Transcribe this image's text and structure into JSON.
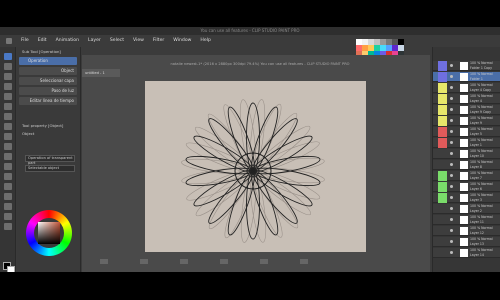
{
  "window": {
    "title": "You can use all features - CLIP STUDIO PAINT PRO",
    "menu": [
      "File",
      "Edit",
      "Animation",
      "Layer",
      "Select",
      "View",
      "Filter",
      "Window",
      "Help"
    ]
  },
  "document": {
    "tab": "untitled - 1",
    "path": "natalie newest-1* (2016 x 2880px 300dpi 79.4%) You can use all features - CLIP STUDIO PAINT PRO"
  },
  "sub_tool": {
    "header": "Sub Tool [Operation]",
    "items": [
      {
        "label": "Operation",
        "selected": true
      },
      {
        "label": "Object",
        "selected": false
      },
      {
        "label": "Seleccionar capa",
        "selected": false
      },
      {
        "label": "Paso de luz",
        "selected": false
      },
      {
        "label": "Editar línea de tiempo",
        "selected": false
      }
    ],
    "property_header": "Tool property [Object]",
    "property_label": "Object",
    "fields": [
      "Operation of transparent part",
      "Selectable object"
    ]
  },
  "layers": [
    {
      "name": "100 % Normal Folder 1 Copy",
      "tag": "#6f6fe0",
      "selected": false
    },
    {
      "name": "100 % Normal Folder 1",
      "tag": "#6f6fe0",
      "selected": true
    },
    {
      "name": "100 % Normal Layer 4 Copy",
      "tag": "#e6e66a",
      "selected": false
    },
    {
      "name": "100 % Normal Layer 4",
      "tag": "#e6e66a",
      "selected": false
    },
    {
      "name": "100 % Normal Layer 9 Copy",
      "tag": "#e6e66a",
      "selected": false
    },
    {
      "name": "100 % Normal Layer 9",
      "tag": "#e6e66a",
      "selected": false
    },
    {
      "name": "100 % Normal Layer 5",
      "tag": "#e05a5a",
      "selected": false
    },
    {
      "name": "100 % Normal Layer 1",
      "tag": "#e05a5a",
      "selected": false
    },
    {
      "name": "100 % Normal Layer 10",
      "tag": "",
      "selected": false
    },
    {
      "name": "100 % Normal Layer 8",
      "tag": "",
      "selected": false
    },
    {
      "name": "100 % Normal Layer 7",
      "tag": "#7adc6a",
      "selected": false
    },
    {
      "name": "100 % Normal Layer 6",
      "tag": "#7adc6a",
      "selected": false
    },
    {
      "name": "100 % Normal Layer 3",
      "tag": "#7adc6a",
      "selected": false
    },
    {
      "name": "100 % Normal Layer 2",
      "tag": "",
      "selected": false
    },
    {
      "name": "100 % Normal Layer 11",
      "tag": "",
      "selected": false
    },
    {
      "name": "100 % Normal Layer 12",
      "tag": "",
      "selected": false
    },
    {
      "name": "100 % Normal Layer 13",
      "tag": "",
      "selected": false
    },
    {
      "name": "100 % Normal Layer 14",
      "tag": "",
      "selected": false
    }
  ],
  "swatches": [
    "#ffffff",
    "#f2f2f2",
    "#d8d8d8",
    "#bfbfbf",
    "#999999",
    "#777777",
    "#555555",
    "#000000",
    "#ff6b6b",
    "#ff9f43",
    "#feca57",
    "#1dd1a1",
    "#48dbfb",
    "#54a0ff",
    "#5f27cd",
    "#c8d6e5",
    "#e17055",
    "#fdcb6e",
    "#00b894",
    "#0984e3",
    "#6c5ce7",
    "#d63031",
    "#e84393",
    "#2d3436"
  ],
  "colors": {
    "accent": "#4a6ea8",
    "paper": "#c8bfb6",
    "main_color": "#000000",
    "sub_color": "#ffffff"
  }
}
